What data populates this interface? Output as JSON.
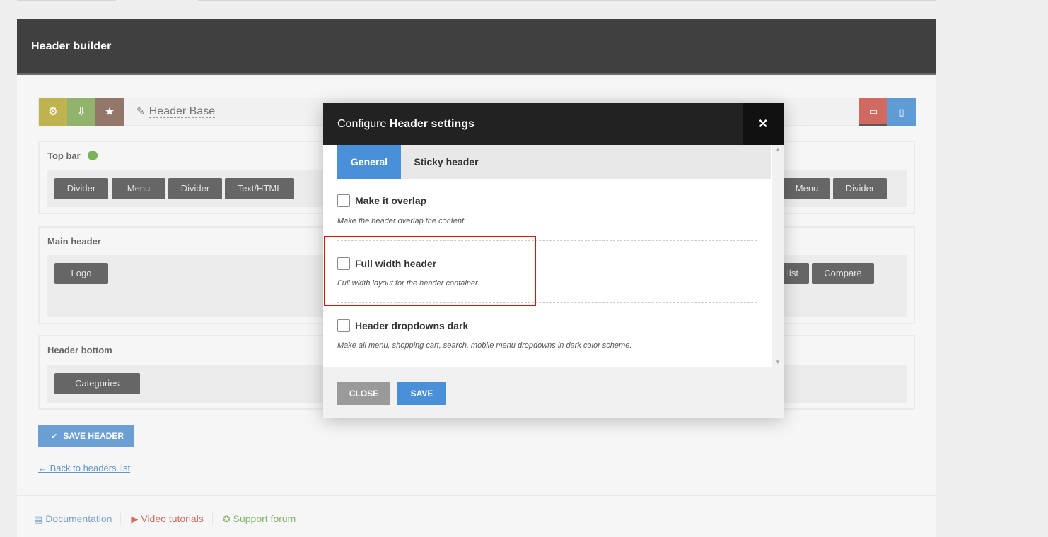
{
  "builder": {
    "title": "Header builder",
    "header_name": "Header Base",
    "toolbar_icons": [
      "gear-icon",
      "import-icon",
      "star-icon",
      "pencil-icon",
      "desktop-icon",
      "mobile-icon"
    ]
  },
  "rows": {
    "top_bar": {
      "title": "Top bar",
      "left_elements": [
        "Divider",
        "Menu",
        "Divider",
        "Text/HTML"
      ],
      "right_elements": [
        "Menu",
        "Divider"
      ]
    },
    "main_header": {
      "title": "Main header",
      "left_elements": [
        "Logo"
      ],
      "right_elements": [
        "list",
        "Compare"
      ]
    },
    "header_bottom": {
      "title": "Header bottom",
      "left_elements": [
        "Categories"
      ]
    }
  },
  "save_header_label": "SAVE HEADER",
  "back_link": "← Back to headers list",
  "footer": {
    "documentation": "Documentation",
    "video_tutorials": "Video tutorials",
    "support_forum": "Support forum"
  },
  "modal": {
    "title_prefix": "Configure",
    "title_bold": "Header settings",
    "close_icon": "×",
    "tabs": [
      "General",
      "Sticky header"
    ],
    "options": [
      {
        "label": "Make it overlap",
        "desc": "Make the header overlap the content.",
        "checked": false
      },
      {
        "label": "Full width header",
        "desc": "Full width layout for the header container.",
        "checked": false
      },
      {
        "label": "Header dropdowns dark",
        "desc": "Make all menu, shopping cart, search, mobile menu dropdowns in dark color scheme.",
        "checked": false
      }
    ],
    "close_label": "CLOSE",
    "save_label": "SAVE"
  },
  "colors": {
    "accent_blue": "#4a90d9",
    "highlight_red": "#e01010",
    "header_black": "#000000"
  }
}
